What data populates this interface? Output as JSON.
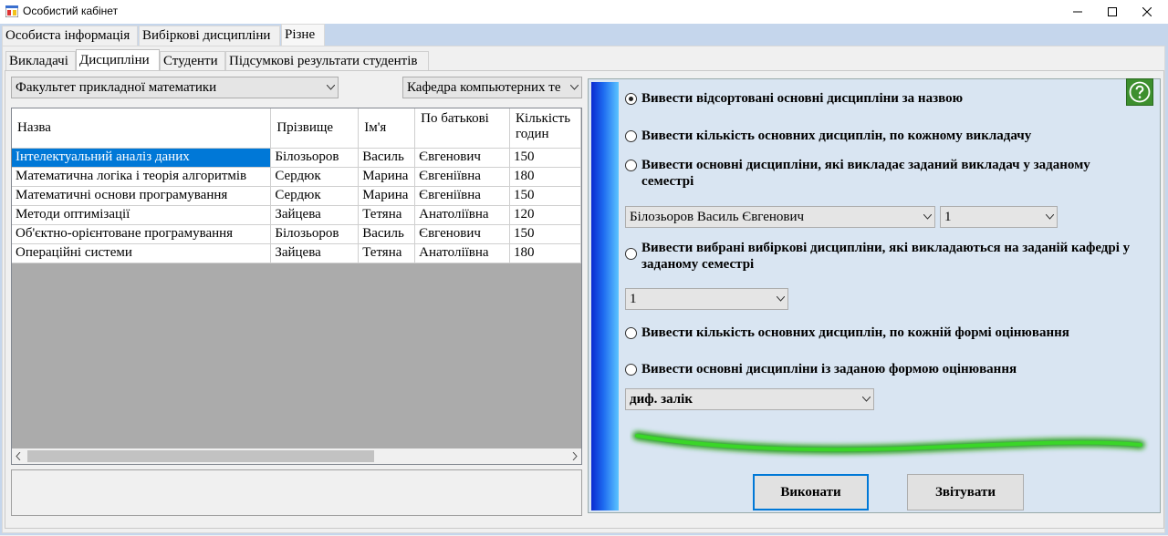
{
  "window": {
    "title": "Особистий кабінет"
  },
  "outer_tabs": [
    "Особиста інформація",
    "Вибіркові дисципліни",
    "Різне"
  ],
  "inner_tabs": [
    "Викладачі",
    "Дисципліни",
    "Студенти",
    "Підсумкові результати студентів"
  ],
  "filters": {
    "faculty": "Факультет прикладної математики",
    "department": "Кафедра компьютерних те"
  },
  "grid": {
    "columns": [
      "Назва",
      "Прізвище",
      "Ім'я",
      "По батькові",
      "Кількість годин"
    ],
    "rows": [
      [
        "Інтелектуальний аналіз даних",
        "Білозьоров",
        "Василь",
        "Євгенович",
        "150"
      ],
      [
        "Математична логіка і теорія алгоритмів",
        "Сердюк",
        "Марина",
        "Євгеніївна",
        "180"
      ],
      [
        "Математичні основи програмування",
        "Сердюк",
        "Марина",
        "Євгеніївна",
        "150"
      ],
      [
        "Методи оптимізації",
        "Зайцева",
        "Тетяна",
        "Анатоліївна",
        "120"
      ],
      [
        "Об'єктно-орієнтоване програмування",
        "Білозьоров",
        "Василь",
        "Євгенович",
        "150"
      ],
      [
        "Операційні системи",
        "Зайцева",
        "Тетяна",
        "Анатоліївна",
        "180"
      ]
    ]
  },
  "options": {
    "o1": "Вивести відсортовані основні дисципліни за назвою",
    "o2": "Вивести кількість основних дисциплін, по кожному викладачу",
    "o3": "Вивести основні дисципліни, які викладає заданий викладач у заданому семестрі",
    "o4": "Вивести вибрані вибіркові дисципліни, які викладаються на заданій кафедрі у заданому семестрі",
    "o5": "Вивести кількість основних дисциплін, по кожній формі оцінювання",
    "o6": "Вивести основні дисципліни із заданою формою оцінювання"
  },
  "selects": {
    "teacher": "Білозьоров Василь Євгенович",
    "semester": "1",
    "semester2": "1",
    "assessment": "диф. залік"
  },
  "buttons": {
    "execute": "Виконати",
    "report": "Звітувати"
  },
  "colors": {
    "selection": "#0078d7",
    "help_icon": "#3d8f2e",
    "accent_stroke": "#2fd11a"
  }
}
